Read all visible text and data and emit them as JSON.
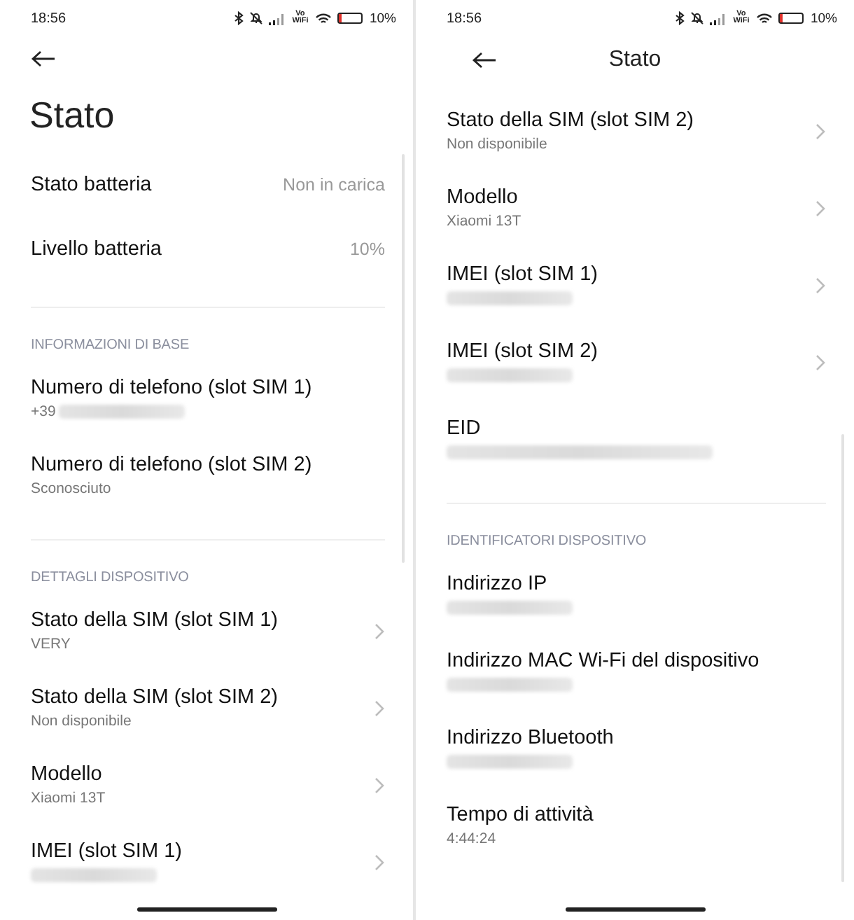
{
  "screens": [
    {
      "status_bar": {
        "time": "18:56",
        "network_label": "Vo WiFi",
        "battery": "10%"
      },
      "header": {
        "kind": "large",
        "title": "Stato"
      },
      "sections": [
        {
          "rows": [
            {
              "kind": "inline",
              "title": "Stato batteria",
              "value": "Non in carica"
            },
            {
              "kind": "inline",
              "title": "Livello batteria",
              "value": "10%"
            }
          ]
        },
        {
          "heading": "INFORMAZIONI DI BASE",
          "rows": [
            {
              "kind": "detail",
              "title": "Numero di telefono (slot SIM 1)",
              "subtitle": "+39",
              "redacted": true,
              "chevron": false
            },
            {
              "kind": "detail",
              "title": "Numero di telefono (slot SIM 2)",
              "subtitle": "Sconosciuto",
              "redacted": false,
              "chevron": false
            }
          ]
        },
        {
          "heading": "DETTAGLI DISPOSITIVO",
          "rows": [
            {
              "kind": "detail",
              "title": "Stato della SIM (slot SIM 1)",
              "subtitle": "VERY",
              "redacted": false,
              "chevron": true
            },
            {
              "kind": "detail",
              "title": "Stato della SIM (slot SIM 2)",
              "subtitle": "Non disponibile",
              "redacted": false,
              "chevron": true
            },
            {
              "kind": "detail",
              "title": "Modello",
              "subtitle": "Xiaomi 13T",
              "redacted": false,
              "chevron": true
            },
            {
              "kind": "detail",
              "title": "IMEI (slot SIM 1)",
              "redacted": true,
              "chevron": true
            }
          ]
        }
      ]
    },
    {
      "status_bar": {
        "time": "18:56",
        "network_label": "Vo WiFi",
        "battery": "10%"
      },
      "header": {
        "kind": "toolbar",
        "title": "Stato"
      },
      "sections": [
        {
          "rows": [
            {
              "kind": "detail",
              "title": "Stato della SIM (slot SIM 2)",
              "subtitle": "Non disponibile",
              "redacted": false,
              "chevron": true
            },
            {
              "kind": "detail",
              "title": "Modello",
              "subtitle": "Xiaomi 13T",
              "redacted": false,
              "chevron": true
            },
            {
              "kind": "detail",
              "title": "IMEI (slot SIM 1)",
              "redacted": true,
              "chevron": true
            },
            {
              "kind": "detail",
              "title": "IMEI (slot SIM 2)",
              "redacted": true,
              "chevron": true
            },
            {
              "kind": "detail",
              "title": "EID",
              "redacted": true,
              "chevron": false
            }
          ]
        },
        {
          "heading": "IDENTIFICATORI DISPOSITIVO",
          "rows": [
            {
              "kind": "detail",
              "title": "Indirizzo IP",
              "redacted": true,
              "chevron": false
            },
            {
              "kind": "detail",
              "title": "Indirizzo MAC Wi-Fi del dispositivo",
              "redacted": true,
              "chevron": false
            },
            {
              "kind": "detail",
              "title": "Indirizzo Bluetooth",
              "redacted": true,
              "chevron": false
            },
            {
              "kind": "detail",
              "title": "Tempo di attività",
              "subtitle": "4:44:24",
              "redacted": false,
              "chevron": false
            }
          ]
        }
      ]
    }
  ]
}
